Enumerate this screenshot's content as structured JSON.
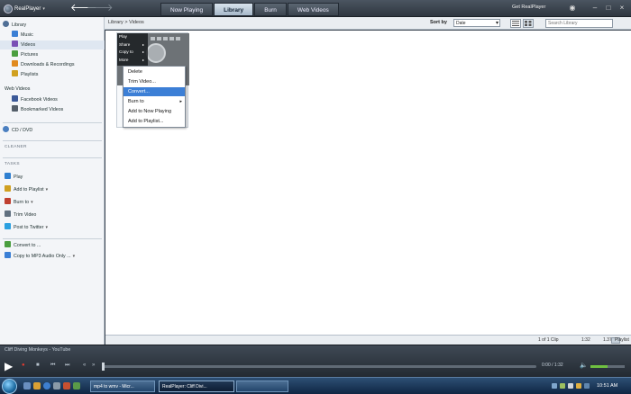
{
  "app": {
    "logo_text": "RealPlayer",
    "get_player": "Get RealPlayer"
  },
  "tabs": [
    {
      "label": "Now Playing",
      "active": false
    },
    {
      "label": "Library",
      "active": true
    },
    {
      "label": "Burn",
      "active": false
    },
    {
      "label": "Web Videos",
      "active": false
    }
  ],
  "toolbar": {
    "breadcrumb": "Library > Videos",
    "sort_label": "Sort by",
    "sort_value": "Date",
    "search_placeholder": "Search Library"
  },
  "sidebar": {
    "library_header": "Library",
    "library_items": [
      {
        "label": "Music",
        "icon": "music-icon",
        "color": "#3a7fd5"
      },
      {
        "label": "Videos",
        "icon": "video-icon",
        "color": "#7a4fb5",
        "selected": true
      },
      {
        "label": "Pictures",
        "icon": "picture-icon",
        "color": "#4a9e3f"
      },
      {
        "label": "Downloads & Recordings",
        "icon": "download-icon",
        "color": "#e08a1e"
      },
      {
        "label": "Playlists",
        "icon": "playlist-icon",
        "color": "#d0a020"
      }
    ],
    "web_videos_header": "Web Videos",
    "web_items": [
      {
        "label": "Facebook Videos",
        "icon": "facebook-icon",
        "color": "#3b5998"
      },
      {
        "label": "Bookmarked Videos",
        "icon": "bookmark-icon",
        "color": "#555f6a"
      }
    ],
    "cd_dvd": "CD / DVD",
    "cleaner_header": "CLEANER",
    "tasks_header": "TASKS",
    "tasks": [
      {
        "label": "Play",
        "icon": "play-icon",
        "color": "#2f7fd0"
      },
      {
        "label": "Add to Playlist",
        "icon": "add-playlist-icon",
        "color": "#d0a020",
        "dropdown": "▾"
      },
      {
        "label": "Burn to",
        "icon": "burn-icon",
        "color": "#c04030",
        "dropdown": "▾"
      },
      {
        "label": "Trim Video",
        "icon": "trim-icon",
        "color": "#607080"
      },
      {
        "label": "Post to Twitter",
        "icon": "twitter-icon",
        "color": "#2aa0e0",
        "dropdown": "▾"
      }
    ],
    "convert_tasks": [
      {
        "label": "Convert to ...",
        "icon": "convert-icon",
        "color": "#4a9e3f"
      },
      {
        "label": "Copy to MP3 Audio Only ...",
        "icon": "copy-mp3-icon",
        "color": "#3a7fd5",
        "dropdown": "▾"
      }
    ]
  },
  "thumbnail_overlay": [
    {
      "label": "Play",
      "arrow": ""
    },
    {
      "label": "Share",
      "arrow": "▸"
    },
    {
      "label": "Copy to",
      "arrow": "▸"
    },
    {
      "label": "More",
      "arrow": "▸"
    }
  ],
  "context_menu": [
    {
      "label": "Delete",
      "highlighted": false,
      "submenu": ""
    },
    {
      "label": "Trim Video...",
      "highlighted": false,
      "submenu": ""
    },
    {
      "label": "Convert...",
      "highlighted": true,
      "submenu": ""
    },
    {
      "label": "Burn to",
      "highlighted": false,
      "submenu": "▸"
    },
    {
      "label": "Add to Now Playing",
      "highlighted": false,
      "submenu": ""
    },
    {
      "label": "Add to Playlist...",
      "highlighted": false,
      "submenu": ""
    }
  ],
  "status": {
    "clip_count": "1 of 1 Clip",
    "duration": "1:32",
    "size": "1.37MB",
    "mini_label": "Playlist"
  },
  "player": {
    "now_playing": "Cliff Diving Monkeys - YouTube",
    "timecode": "0:00 / 1:32",
    "volume": 0.5
  },
  "taskbar": {
    "tasks": [
      {
        "label": "mp4 to wmv - Micr...",
        "active": false
      },
      {
        "label": "RealPlayer: Cliff Divi...",
        "active": true
      },
      {
        "label": "",
        "active": false
      }
    ],
    "clock": "10:51 AM"
  },
  "colors": {
    "accent": "#3c7fd6",
    "volume": "#6fc040"
  }
}
